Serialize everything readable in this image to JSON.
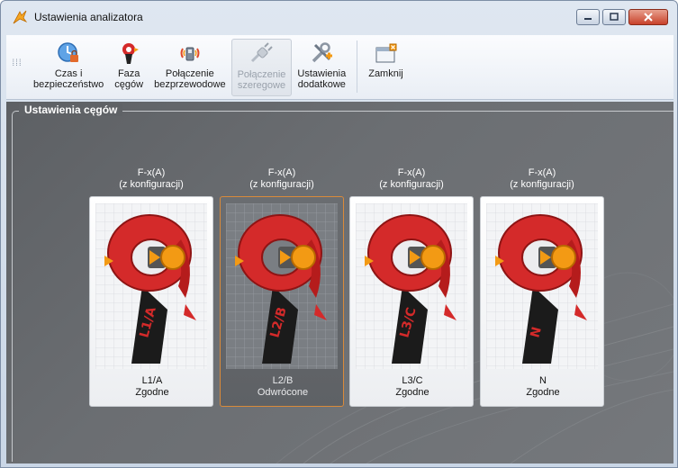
{
  "window": {
    "title": "Ustawienia analizatora"
  },
  "toolbar": {
    "items": [
      {
        "line1": "Czas i",
        "line2": "bezpieczeństwo",
        "icon": "clock-lock-icon",
        "enabled": true
      },
      {
        "line1": "Faza",
        "line2": "cęgów",
        "icon": "clamp-phase-icon",
        "enabled": true
      },
      {
        "line1": "Połączenie",
        "line2": "bezprzewodowe",
        "icon": "wireless-icon",
        "enabled": true
      },
      {
        "line1": "Połączenie",
        "line2": "szeregowe",
        "icon": "serial-plug-icon",
        "enabled": false
      },
      {
        "line1": "Ustawienia",
        "line2": "dodatkowe",
        "icon": "tools-icon",
        "enabled": true
      },
      {
        "line1": "Zamknij",
        "line2": "",
        "icon": "close-window-icon",
        "enabled": true
      }
    ]
  },
  "group": {
    "title": "Ustawienia cęgów"
  },
  "clamps": [
    {
      "type": "F-x(A)",
      "source": "(z konfiguracji)",
      "phase": "L1/A",
      "status": "Zgodne",
      "label_on_clamp": "L1/A",
      "selected": false
    },
    {
      "type": "F-x(A)",
      "source": "(z konfiguracji)",
      "phase": "L2/B",
      "status": "Odwrócone",
      "label_on_clamp": "L2/B",
      "selected": true
    },
    {
      "type": "F-x(A)",
      "source": "(z konfiguracji)",
      "phase": "L3/C",
      "status": "Zgodne",
      "label_on_clamp": "L3/C",
      "selected": false
    },
    {
      "type": "F-x(A)",
      "source": "(z konfiguracji)",
      "phase": "N",
      "status": "Zgodne",
      "label_on_clamp": "N",
      "selected": false
    }
  ],
  "colors": {
    "clamp_red": "#d42a2a",
    "arrow_orange": "#f39a14",
    "selected_border": "#d98a3a"
  }
}
